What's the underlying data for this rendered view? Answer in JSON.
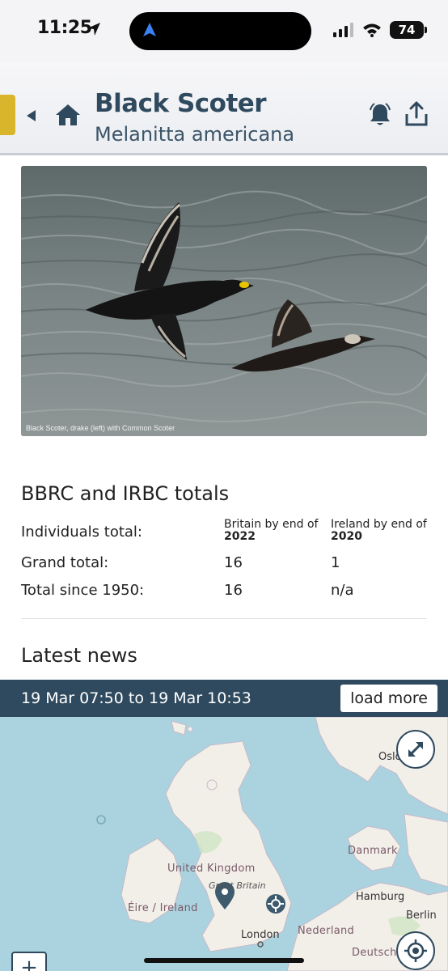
{
  "status_bar": {
    "time": "11:25",
    "battery": "74"
  },
  "header": {
    "title": "Black Scoter",
    "subtitle": "Melanitta americana"
  },
  "photo": {
    "caption": "Black Scoter, drake (left) with Common Scoter"
  },
  "totals": {
    "title": "BBRC and IRBC totals",
    "britain_head": "Britain by end of",
    "britain_year": "2022",
    "ireland_head": "Ireland by end of",
    "ireland_year": "2020",
    "rows": [
      {
        "label": "Individuals total:"
      },
      {
        "label": "Grand total:",
        "britain": "16",
        "ireland": "1"
      },
      {
        "label": "Total since 1950:",
        "britain": "16",
        "ireland": "n/a"
      }
    ]
  },
  "news": {
    "title": "Latest news",
    "range": "19 Mar 07:50 to 19 Mar 10:53",
    "load_more": "load more"
  },
  "map": {
    "labels": {
      "oslo": "Oslo",
      "danmark": "Danmark",
      "united_kingdom": "United Kingdom",
      "great_britain": "Great Britain",
      "eire": "Éire / Ireland",
      "hamburg": "Hamburg",
      "berlin": "Berlin",
      "london": "London",
      "nederland": "Nederland",
      "deutschland": "Deutsch"
    },
    "zoom_in": "+"
  },
  "colors": {
    "header_text": "#2f4a5e",
    "accent_tab": "#d9b52b",
    "map_water": "#aad3df"
  }
}
